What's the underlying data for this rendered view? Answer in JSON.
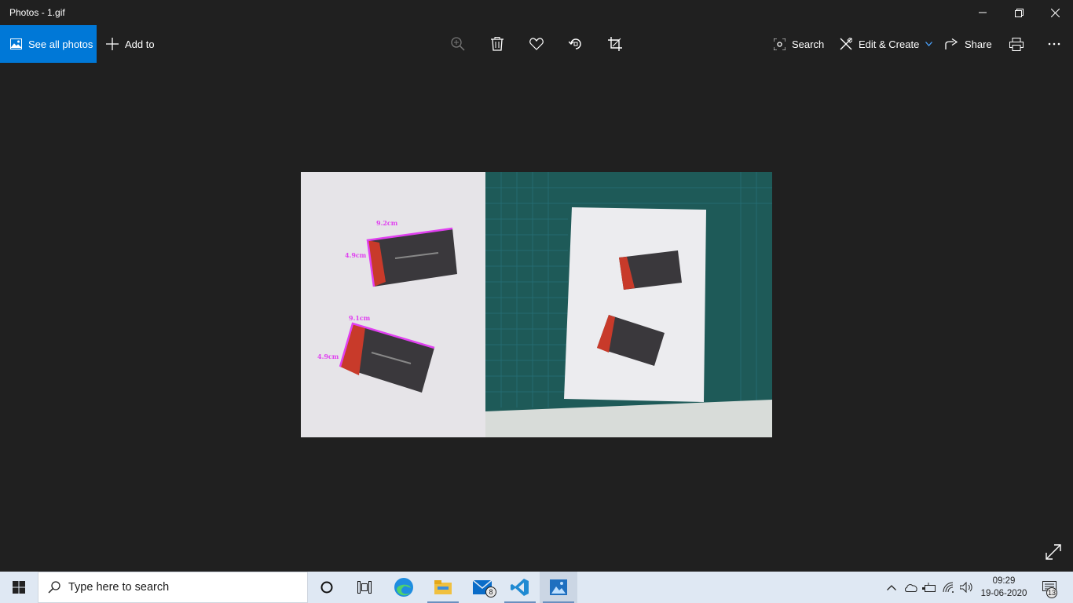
{
  "window": {
    "title": "Photos - 1.gif",
    "controls": {
      "minimize": "minimize-icon",
      "restore": "restore-icon",
      "close": "close-icon"
    }
  },
  "toolbar": {
    "see_all_photos": "See all photos",
    "add_to": "Add to",
    "search": "Search",
    "edit_create": "Edit & Create",
    "share": "Share",
    "icons": [
      "zoom-in-icon",
      "delete-icon",
      "favorite-icon",
      "rotate-icon",
      "crop-icon",
      "print-icon",
      "more-icon"
    ]
  },
  "photo": {
    "measurements": {
      "card1_width": "9.2cm",
      "card1_height": "4.9cm",
      "card2_width": "9.1cm",
      "card2_height": "4.9cm"
    }
  },
  "taskbar": {
    "search_placeholder": "Type here to search",
    "mail_badge": "8",
    "notification_badge": "13",
    "time": "09:29",
    "date": "19-06-2020"
  },
  "colors": {
    "accent": "#0078d7",
    "measure": "#e040f0",
    "background": "#202020",
    "taskbar": "#dfe8f3"
  }
}
